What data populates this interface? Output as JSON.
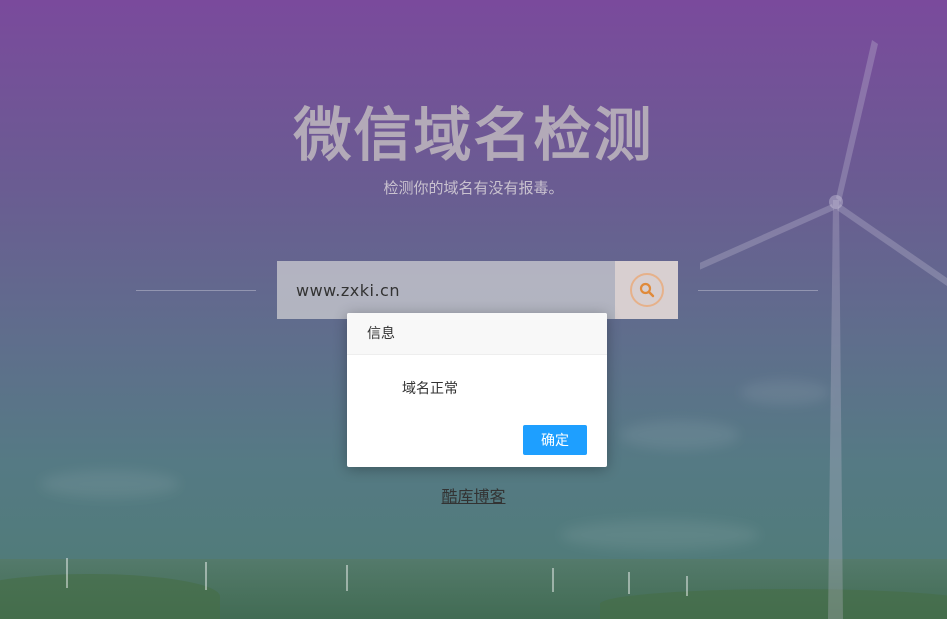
{
  "hero": {
    "title": "微信域名检测",
    "subtitle": "检测你的域名有没有报毒。"
  },
  "search": {
    "value": "www.zxki.cn",
    "button_icon": "search-icon"
  },
  "footer": {
    "link_label": "酷库博客"
  },
  "dialog": {
    "title": "信息",
    "message": "域名正常",
    "confirm_label": "确定"
  },
  "colors": {
    "accent": "#1e9fff",
    "search_icon": "#e6b18a",
    "title": "#b3aab8"
  }
}
